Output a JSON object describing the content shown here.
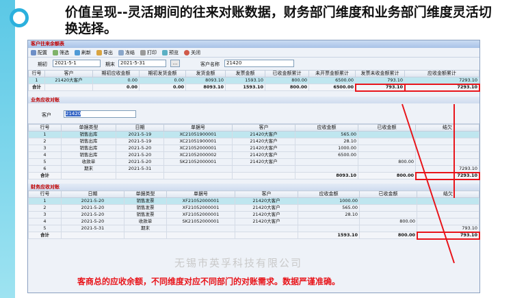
{
  "slide": {
    "title": "价值呈现--灵活期间的往来对账数据，财务部门维度和业务部门维度灵活切换选择。",
    "caption": "客商总的应收余额，不同维度对应不同部门的对账需求。数据严谨准确。",
    "watermark": "无锡市英孚科技有限公司"
  },
  "window": {
    "title": "客户往来余额表"
  },
  "toolbar": {
    "config": "配置",
    "filter": "筛选",
    "refresh": "刷新",
    "export": "导出",
    "freeze": "冻结",
    "print": "打印",
    "preview": "预览",
    "close": "关闭"
  },
  "filter": {
    "start_label": "期初",
    "start_value": "2021-5-1",
    "end_label": "期末",
    "end_value": "2021-5-31",
    "btn": "...",
    "customer_label": "客户名称",
    "customer_value": "21420"
  },
  "summary": {
    "headers": [
      "行号",
      "客户",
      "期初应收金额",
      "期初发货金额",
      "发货金额",
      "发票金额",
      "已收金额累计",
      "未开票金额累计",
      "发票未收金额累计",
      "应收金额累计"
    ],
    "rows": [
      [
        "1",
        "21420大客户",
        "0.00",
        "0.00",
        "8093.10",
        "1593.10",
        "800.00",
        "6500.00",
        "793.10",
        "7293.10"
      ]
    ],
    "total": [
      "合计",
      "",
      "0.00",
      "0.00",
      "8093.10",
      "1593.10",
      "800.00",
      "6500.00",
      "793.10",
      "7293.10"
    ]
  },
  "business": {
    "title": "业务应收对账",
    "customer_label": "客户",
    "customer_value": "21420",
    "headers": [
      "行号",
      "单据类型",
      "日期",
      "单据号",
      "客户",
      "应收金额",
      "已收金额",
      "结欠"
    ],
    "rows": [
      [
        "1",
        "销售出库",
        "2021-5-19",
        "XC21051900001",
        "21420大客户",
        "565.00",
        "",
        ""
      ],
      [
        "2",
        "销售出库",
        "2021-5-19",
        "XC21051900001",
        "21420大客户",
        "28.10",
        "",
        ""
      ],
      [
        "3",
        "销售出库",
        "2021-5-20",
        "XC21052000001",
        "21420大客户",
        "1000.00",
        "",
        ""
      ],
      [
        "4",
        "销售出库",
        "2021-5-20",
        "XC21052000002",
        "21420大客户",
        "6500.00",
        "",
        ""
      ],
      [
        "5",
        "收款单",
        "2021-5-20",
        "SK21052000001",
        "21420大客户",
        "",
        "800.00",
        ""
      ],
      [
        "6",
        "期末",
        "2021-5-31",
        "",
        "",
        "",
        "",
        "7293.10"
      ]
    ],
    "total": [
      "合计",
      "",
      "",
      "",
      "",
      "8093.10",
      "800.00",
      "7293.10"
    ]
  },
  "finance": {
    "title": "财务应收对账",
    "headers": [
      "行号",
      "日期",
      "单据类型",
      "单据号",
      "客户",
      "应收金额",
      "已收金额",
      "结欠"
    ],
    "rows": [
      [
        "1",
        "2021-5-20",
        "销售发票",
        "XF21052000001",
        "21420大客户",
        "1000.00",
        "",
        ""
      ],
      [
        "2",
        "2021-5-20",
        "销售发票",
        "XF21052000001",
        "21420大客户",
        "565.00",
        "",
        ""
      ],
      [
        "3",
        "2021-5-20",
        "销售发票",
        "XF21052000001",
        "21420大客户",
        "28.10",
        "",
        ""
      ],
      [
        "4",
        "2021-5-20",
        "收款单",
        "SK21052000001",
        "21420大客户",
        "",
        "800.00",
        ""
      ],
      [
        "5",
        "2021-5-31",
        "期末",
        "",
        "",
        "",
        "",
        "793.10"
      ]
    ],
    "total": [
      "合计",
      "",
      "",
      "",
      "",
      "1593.10",
      "800.00",
      "793.10"
    ]
  }
}
